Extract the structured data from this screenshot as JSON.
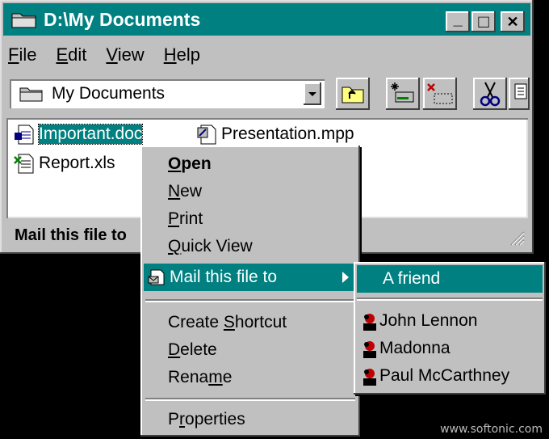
{
  "window": {
    "title": "D:\\My Documents",
    "minimize_glyph": "_",
    "maximize_glyph": "□",
    "close_glyph": "✕"
  },
  "menubar": [
    {
      "label": "File",
      "accel": "F",
      "rest": "ile"
    },
    {
      "label": "Edit",
      "accel": "E",
      "rest": "dit"
    },
    {
      "label": "View",
      "accel": "V",
      "rest": "iew"
    },
    {
      "label": "Help",
      "accel": "H",
      "rest": "elp"
    }
  ],
  "toolbar": {
    "location_value": "My Documents",
    "icons": [
      "up-folder-icon",
      "map-drive-icon",
      "disconnect-drive-icon",
      "cut-icon",
      "copy-icon"
    ]
  },
  "files": [
    {
      "name": "Important.doc",
      "icon": "word-doc-icon",
      "selected": true
    },
    {
      "name": "Presentation.mpp",
      "icon": "project-file-icon",
      "selected": false
    },
    {
      "name": "Report.xls",
      "icon": "excel-file-icon",
      "selected": false
    }
  ],
  "status": {
    "text": "Mail this file to"
  },
  "context_menu": {
    "items": [
      {
        "label": "Open",
        "accel": "O",
        "bold": true
      },
      {
        "label": "New",
        "accel": "N"
      },
      {
        "label": "Print",
        "accel": "P"
      },
      {
        "label": "Quick View",
        "accel": "Q"
      },
      {
        "label": "Mail this file to",
        "accel": "",
        "highlighted": true,
        "has_submenu": true
      },
      {
        "label": "Create Shortcut",
        "accel": "S"
      },
      {
        "label": "Delete",
        "accel": "D"
      },
      {
        "label": "Rename",
        "accel": "m"
      },
      {
        "label": "Properties",
        "accel": "r"
      }
    ]
  },
  "submenu": {
    "items": [
      {
        "label": "A friend",
        "highlighted": true
      },
      {
        "label": "John Lennon",
        "icon": "person-icon"
      },
      {
        "label": "Madonna",
        "icon": "person-icon"
      },
      {
        "label": "Paul McCarthney",
        "icon": "person-icon"
      }
    ]
  },
  "watermark": "www.softonic.com",
  "colors": {
    "titlebar": "#008080",
    "face": "#c0c0c0",
    "highlight": "#008080"
  }
}
